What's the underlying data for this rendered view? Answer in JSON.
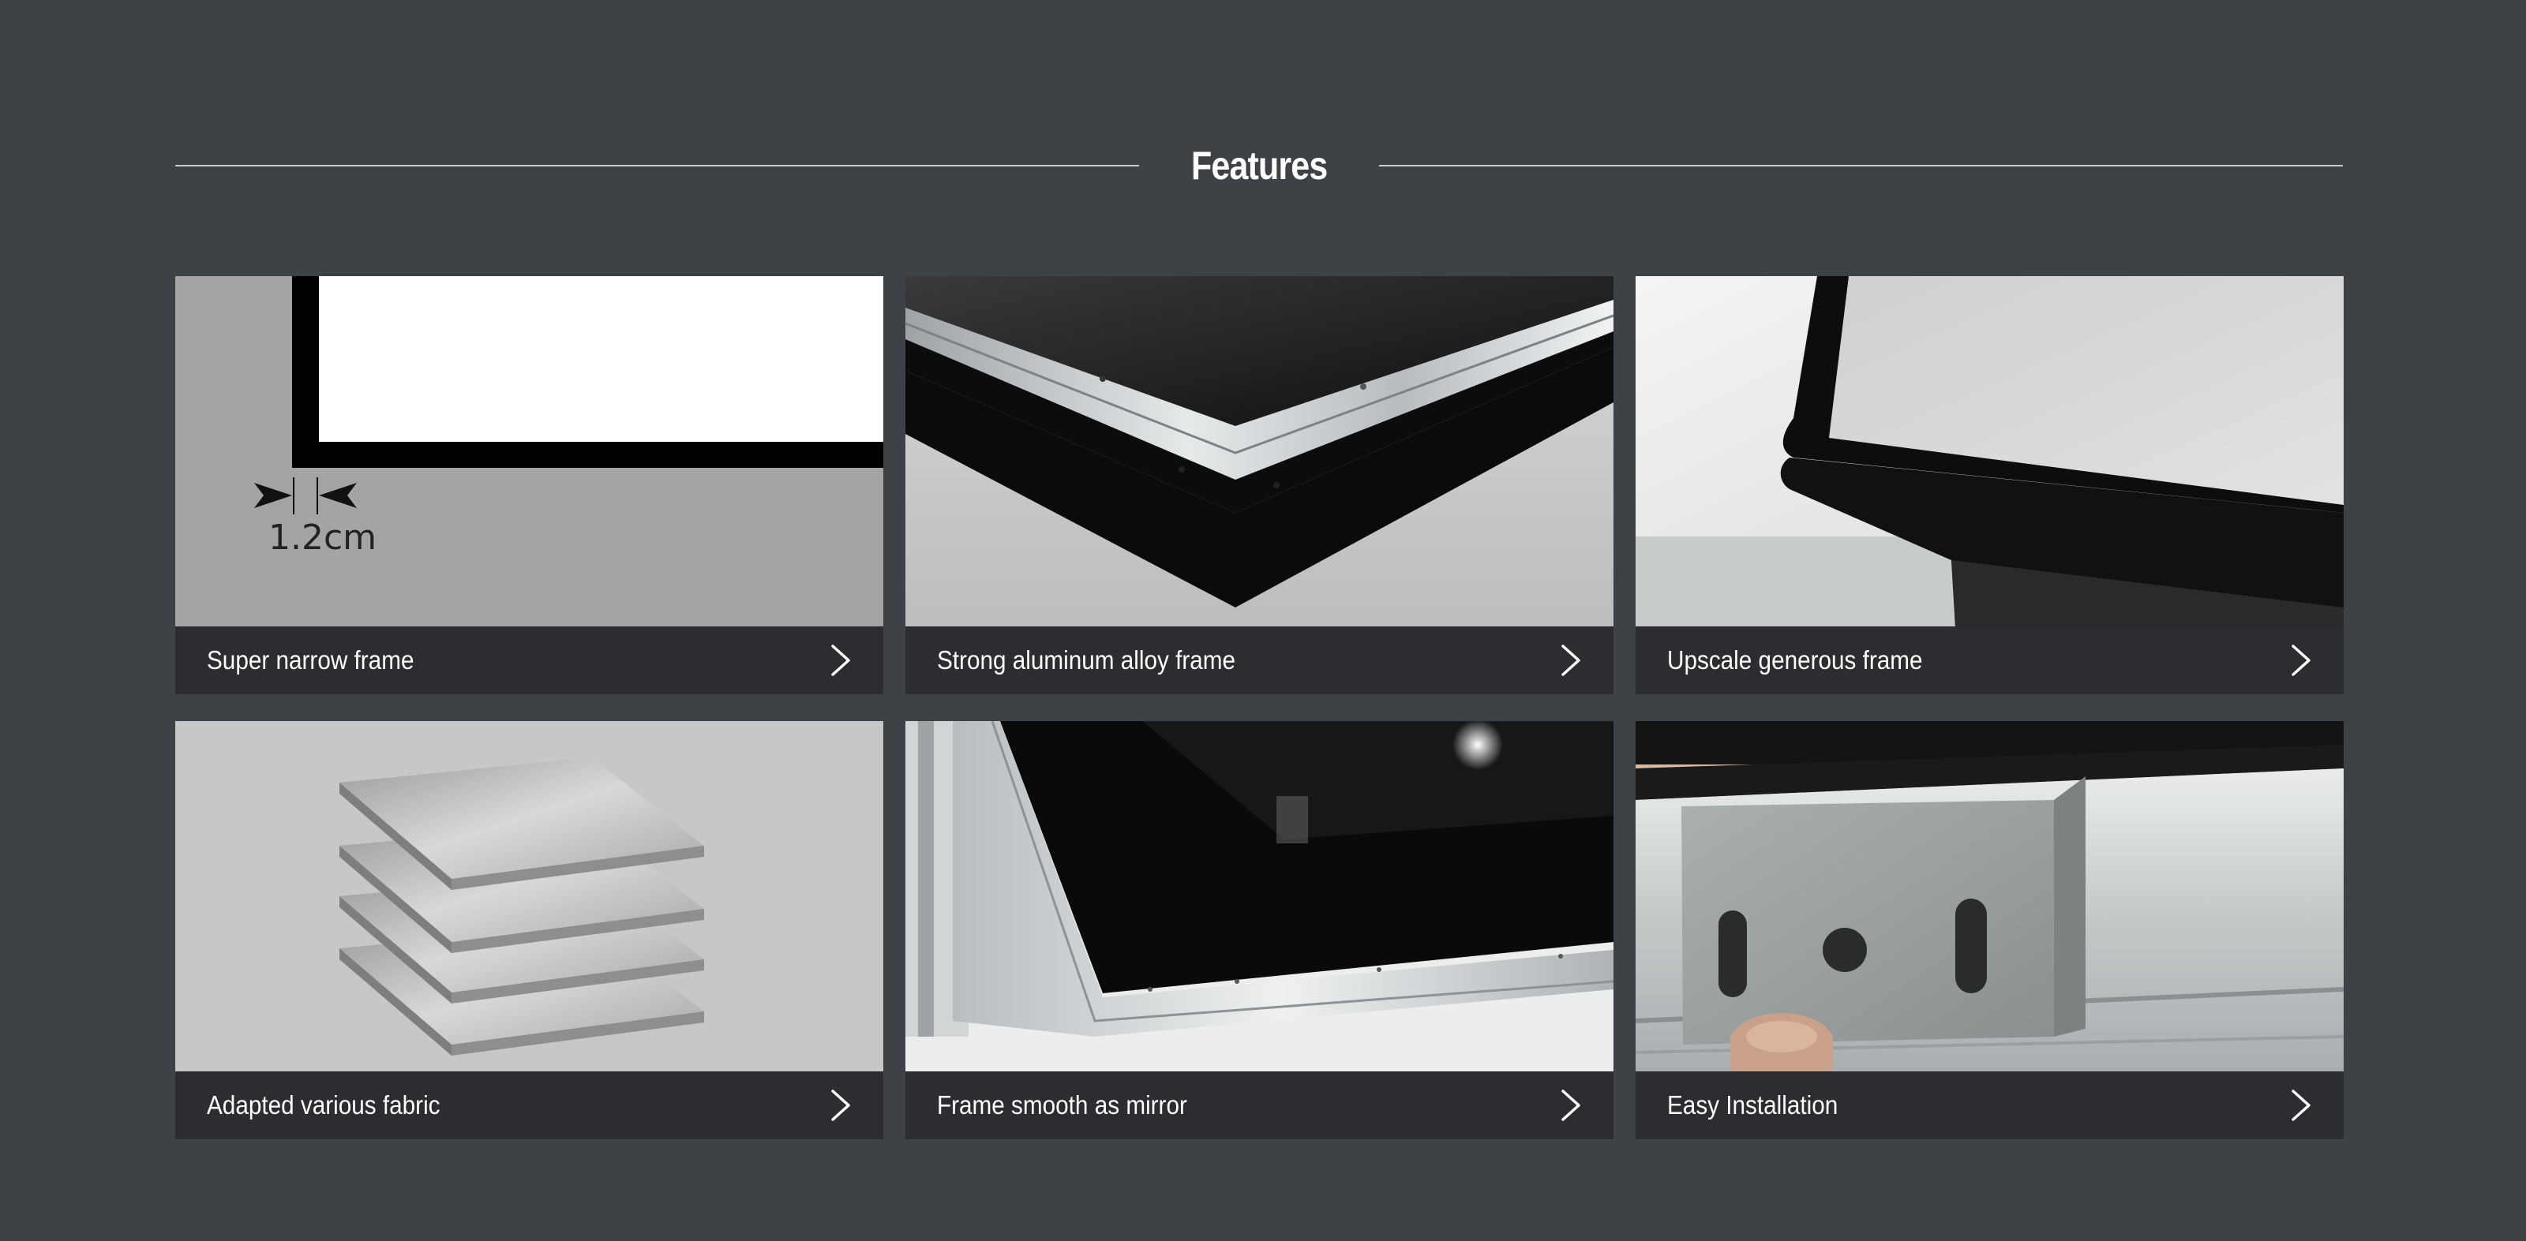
{
  "section": {
    "title": "Features"
  },
  "cards": [
    {
      "label": "Super narrow frame",
      "annotation": "1.2cm",
      "icon": "chevron-right-icon"
    },
    {
      "label": "Strong aluminum alloy frame",
      "icon": "chevron-right-icon"
    },
    {
      "label": "Upscale generous frame",
      "icon": "chevron-right-icon"
    },
    {
      "label": "Adapted various fabric",
      "icon": "chevron-right-icon"
    },
    {
      "label": "Frame smooth as mirror",
      "icon": "chevron-right-icon"
    },
    {
      "label": "Easy Installation",
      "icon": "chevron-right-icon"
    }
  ],
  "colors": {
    "background": "#3e4146",
    "caption_bar": "#2c2d30",
    "text": "#ffffff",
    "divider": "#c9cbce"
  }
}
